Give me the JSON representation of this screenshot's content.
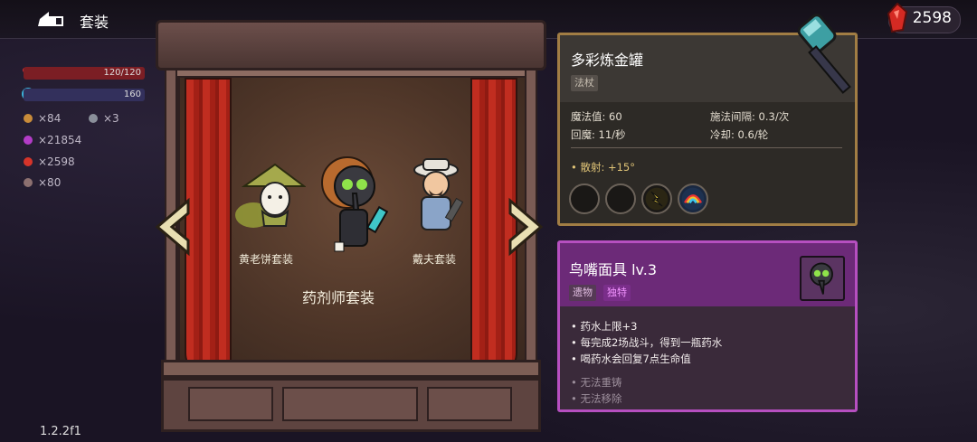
{
  "header": {
    "title": "套装",
    "gems": "2598"
  },
  "player": {
    "hp": "120/120",
    "mp": "160",
    "resources": [
      {
        "icon": "coin-icon",
        "value": "×84",
        "color": "#c98c3a"
      },
      {
        "icon": "key-icon",
        "value": "×3",
        "color": "#8a8f9a"
      },
      {
        "icon": "purple-gem-icon",
        "value": "×21854",
        "color": "#b33cc7"
      },
      {
        "icon": "red-gem-icon",
        "value": "×2598",
        "color": "#d6342a"
      },
      {
        "icon": "parts-icon",
        "value": "×80",
        "color": "#8c7070"
      }
    ]
  },
  "stage": {
    "left_char": "黄老饼套装",
    "right_char": "戴夫套装",
    "selected_set": "药剂师套装"
  },
  "weapon": {
    "name": "多彩炼金罐",
    "type_tag": "法杖",
    "stats": [
      {
        "label": "魔法值: 60"
      },
      {
        "label": "施法间隔: 0.3/次"
      },
      {
        "label": "回魔: 11/秒"
      },
      {
        "label": "冷却: 0.6/轮"
      }
    ],
    "spread": "散射: +15°"
  },
  "relic": {
    "name": "鸟嘴面具 lv.3",
    "tag1": "遗物",
    "tag2": "独特",
    "effects": [
      "药水上限+3",
      "每完成2场战斗，得到一瓶药水",
      "喝药水会回复7点生命值"
    ],
    "notes": [
      "无法重铸",
      "无法移除"
    ]
  },
  "footer": {
    "version": "1.2.2f1"
  },
  "colors": {
    "weapon_border": "#a17d44",
    "relic_border": "#b64fc0",
    "relic_header": "#6c2a78"
  }
}
